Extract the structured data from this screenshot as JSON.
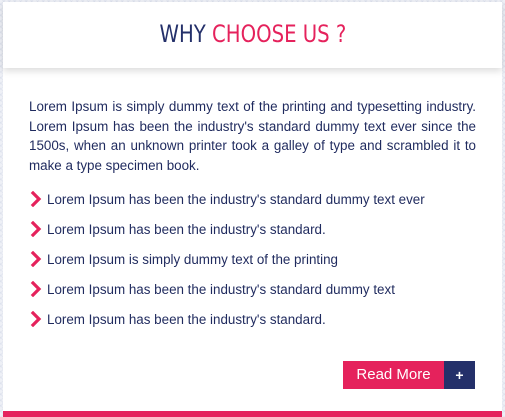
{
  "header": {
    "title_part1": "WHY",
    "title_part2": "CHOOSE US ?"
  },
  "intro": "Lorem Ipsum is simply dummy text of the printing and typesetting industry. Lorem Ipsum has been the industry's standard dummy text ever since the 1500s, when an unknown printer took a galley of type and scrambled it to make a type specimen book.",
  "features": [
    {
      "icon": "chevron-right-icon",
      "text": "Lorem Ipsum has been the industry's standard dummy text ever"
    },
    {
      "icon": "chevron-right-icon",
      "text": "Lorem Ipsum has been the industry's standard."
    },
    {
      "icon": "chevron-right-icon",
      "text": "Lorem Ipsum is simply dummy text of the printing"
    },
    {
      "icon": "chevron-right-icon",
      "text": "Lorem Ipsum has been the industry's standard dummy text"
    },
    {
      "icon": "chevron-right-icon",
      "text": "Lorem Ipsum has been the industry's standard."
    }
  ],
  "actions": {
    "read_more_label": "Read More",
    "expand_label": "+"
  },
  "colors": {
    "navy": "#24306a",
    "accent": "#e5225c"
  }
}
